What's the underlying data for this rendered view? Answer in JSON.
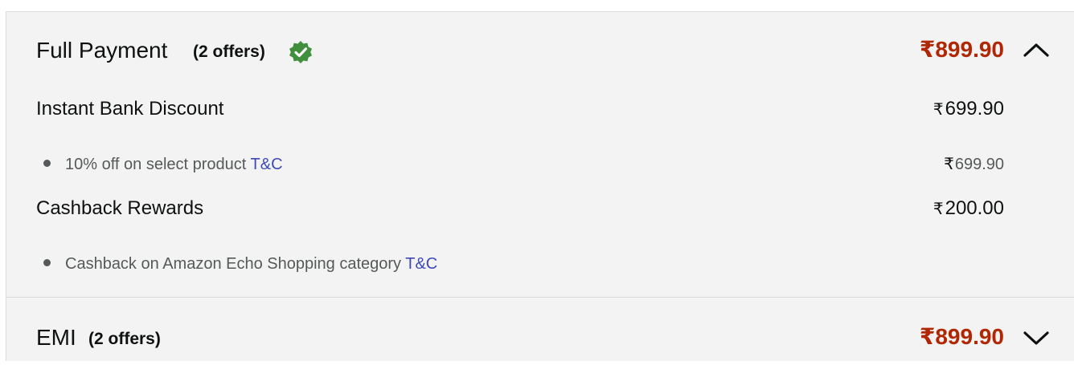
{
  "full_payment": {
    "title": "Full Payment",
    "offers": "(2 offers)",
    "price": "₹899.90",
    "expanded": true,
    "items": [
      {
        "title": "Instant Bank Discount",
        "amount": "699.90",
        "detail": "10% off on select product",
        "detail_link": "T&C",
        "detail_amount": "699.90"
      },
      {
        "title": "Cashback Rewards",
        "amount": "200.00",
        "detail": "Cashback on Amazon Echo Shopping category",
        "detail_link": "T&C"
      }
    ]
  },
  "emi": {
    "title": "EMI",
    "offers": "(2 offers)",
    "price": "₹899.90",
    "expanded": false
  },
  "currency_symbol": "₹",
  "icons": {
    "verified": "verified-badge-icon",
    "collapse": "chevron-up-icon",
    "expand": "chevron-down-icon"
  },
  "colors": {
    "price": "#b12704",
    "link": "#3c4ab8",
    "verified": "#3f8f3c",
    "panel_bg": "#f3f3f3"
  }
}
